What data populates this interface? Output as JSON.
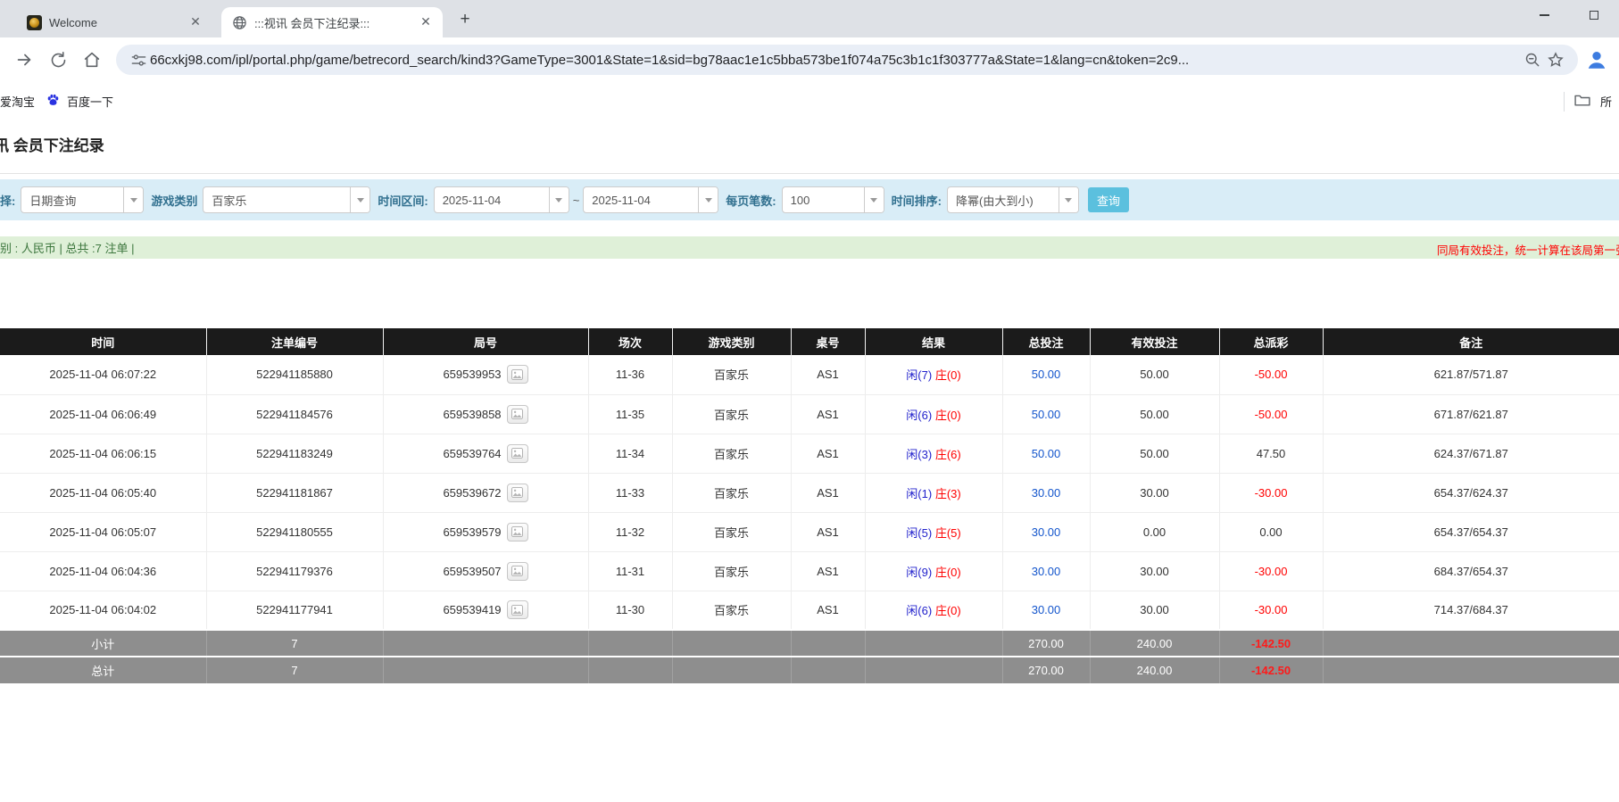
{
  "browser": {
    "tabs": [
      {
        "title": "Welcome"
      },
      {
        "title": ":::视讯 会员下注纪录:::"
      }
    ],
    "url": "66cxkj98.com/ipl/portal.php/game/betrecord_search/kind3?GameType=3001&State=1&sid=bg78aac1e1c5bba573be1f074a75c3b1c1f303777a&State=1&lang=cn&token=2c9...",
    "bookmarks": {
      "items": [
        {
          "label": "爱淘宝"
        },
        {
          "label": "百度一下"
        }
      ],
      "overflow_label": "所"
    }
  },
  "page": {
    "title": "讯 会员下注纪录",
    "filters": {
      "query_type": {
        "label": "择:",
        "value": "日期查询"
      },
      "game_type": {
        "label": "游戏类别",
        "value": "百家乐"
      },
      "date_range": {
        "label": "时间区间:",
        "from": "2025-11-04",
        "separator": "~",
        "to": "2025-11-04"
      },
      "page_size": {
        "label": "每页笔数:",
        "value": "100"
      },
      "sort": {
        "label": "时间排序:",
        "value": "降幂(由大到小)"
      },
      "search_button": "查询"
    },
    "summary": {
      "left": "别 : 人民币 | 总共 :7 注单 |",
      "note": "同局有效投注，统一计算在该局第一张注"
    },
    "table": {
      "headers": [
        "时间",
        "注单编号",
        "局号",
        "场次",
        "游戏类别",
        "桌号",
        "结果",
        "总投注",
        "有效投注",
        "总派彩",
        "备注"
      ],
      "rows": [
        {
          "time": "2025-11-04 06:07:22",
          "bet_no": "522941185880",
          "round_no": "659539953",
          "session": "11-36",
          "game_type": "百家乐",
          "table_no": "AS1",
          "result_player": "闲(7)",
          "result_banker": "庄(0)",
          "total_bet": "50.00",
          "valid_bet": "50.00",
          "payout": "-50.00",
          "remark": "621.87/571.87"
        },
        {
          "time": "2025-11-04 06:06:49",
          "bet_no": "522941184576",
          "round_no": "659539858",
          "session": "11-35",
          "game_type": "百家乐",
          "table_no": "AS1",
          "result_player": "闲(6)",
          "result_banker": "庄(0)",
          "total_bet": "50.00",
          "valid_bet": "50.00",
          "payout": "-50.00",
          "remark": "671.87/621.87"
        },
        {
          "time": "2025-11-04 06:06:15",
          "bet_no": "522941183249",
          "round_no": "659539764",
          "session": "11-34",
          "game_type": "百家乐",
          "table_no": "AS1",
          "result_player": "闲(3)",
          "result_banker": "庄(6)",
          "total_bet": "50.00",
          "valid_bet": "50.00",
          "payout": "47.50",
          "remark": "624.37/671.87"
        },
        {
          "time": "2025-11-04 06:05:40",
          "bet_no": "522941181867",
          "round_no": "659539672",
          "session": "11-33",
          "game_type": "百家乐",
          "table_no": "AS1",
          "result_player": "闲(1)",
          "result_banker": "庄(3)",
          "total_bet": "30.00",
          "valid_bet": "30.00",
          "payout": "-30.00",
          "remark": "654.37/624.37"
        },
        {
          "time": "2025-11-04 06:05:07",
          "bet_no": "522941180555",
          "round_no": "659539579",
          "session": "11-32",
          "game_type": "百家乐",
          "table_no": "AS1",
          "result_player": "闲(5)",
          "result_banker": "庄(5)",
          "total_bet": "30.00",
          "valid_bet": "0.00",
          "payout": "0.00",
          "remark": "654.37/654.37"
        },
        {
          "time": "2025-11-04 06:04:36",
          "bet_no": "522941179376",
          "round_no": "659539507",
          "session": "11-31",
          "game_type": "百家乐",
          "table_no": "AS1",
          "result_player": "闲(9)",
          "result_banker": "庄(0)",
          "total_bet": "30.00",
          "valid_bet": "30.00",
          "payout": "-30.00",
          "remark": "684.37/654.37"
        },
        {
          "time": "2025-11-04 06:04:02",
          "bet_no": "522941177941",
          "round_no": "659539419",
          "session": "11-30",
          "game_type": "百家乐",
          "table_no": "AS1",
          "result_player": "闲(6)",
          "result_banker": "庄(0)",
          "total_bet": "30.00",
          "valid_bet": "30.00",
          "payout": "-30.00",
          "remark": "714.37/684.37"
        }
      ],
      "subtotal": {
        "label": "小计",
        "count": "7",
        "total_bet": "270.00",
        "valid_bet": "240.00",
        "payout": "-142.50"
      },
      "grand_total": {
        "label": "总计",
        "count": "7",
        "total_bet": "270.00",
        "valid_bet": "240.00",
        "payout": "-142.50"
      }
    },
    "colors": {
      "filter_bar_bg": "#d9edf7",
      "search_button_bg": "#5bc0de",
      "summary_bar_bg": "#dff0d8",
      "summary_text": "#3c763d",
      "note_red": "#ff0000",
      "table_header_bg": "#1b1b1b",
      "link_blue": "#1355cc",
      "player_blue": "#2222cc",
      "banker_red": "#ff0000",
      "subtotal_row_bg": "#8e8e8e"
    }
  }
}
